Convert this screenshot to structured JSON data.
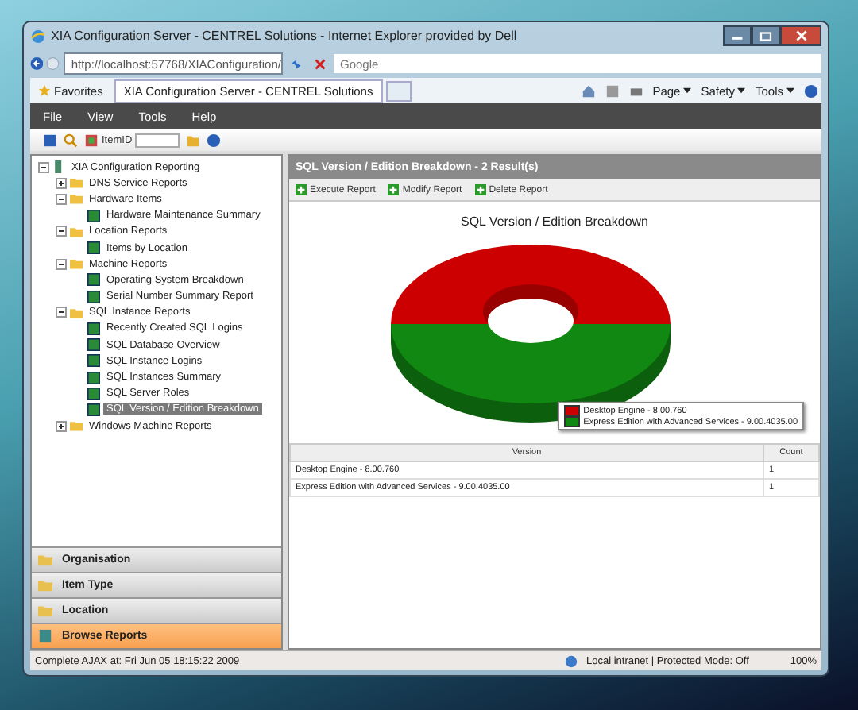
{
  "window": {
    "title": "XIA Configuration Server - CENTREL Solutions - Internet Explorer provided by Dell"
  },
  "address_bar": {
    "value": "http://localhost:57768/XIAConfiguration/"
  },
  "search": {
    "placeholder": "Google"
  },
  "favorites_bar": {
    "favorites": "Favorites",
    "tab": "XIA Configuration Server - CENTREL Solutions",
    "commands": [
      "Page",
      "Safety",
      "Tools"
    ]
  },
  "menu": [
    "File",
    "View",
    "Tools",
    "Help"
  ],
  "toolbar": {
    "item_id_label": "ItemID"
  },
  "tree": [
    {
      "label": "XIA Configuration Reporting",
      "kind": "root",
      "expanded": true,
      "selected": false,
      "children": [
        {
          "label": "DNS Service Reports",
          "kind": "folder",
          "expanded": false,
          "selected": false
        },
        {
          "label": "Hardware Items",
          "kind": "folder",
          "expanded": true,
          "selected": false,
          "children": [
            {
              "label": "Hardware Maintenance Summary",
              "kind": "report",
              "selected": false
            }
          ]
        },
        {
          "label": "Location Reports",
          "kind": "folder",
          "expanded": true,
          "selected": false,
          "children": [
            {
              "label": "Items by Location",
              "kind": "report",
              "selected": false
            }
          ]
        },
        {
          "label": "Machine Reports",
          "kind": "folder",
          "expanded": true,
          "selected": false,
          "children": [
            {
              "label": "Operating System Breakdown",
              "kind": "report",
              "selected": false
            },
            {
              "label": "Serial Number Summary Report",
              "kind": "report",
              "selected": false
            }
          ]
        },
        {
          "label": "SQL Instance Reports",
          "kind": "folder",
          "expanded": true,
          "selected": false,
          "children": [
            {
              "label": "Recently Created SQL Logins",
              "kind": "report",
              "selected": false
            },
            {
              "label": "SQL Database Overview",
              "kind": "report",
              "selected": false
            },
            {
              "label": "SQL Instance Logins",
              "kind": "report",
              "selected": false
            },
            {
              "label": "SQL Instances Summary",
              "kind": "report",
              "selected": false
            },
            {
              "label": "SQL Server Roles",
              "kind": "report",
              "selected": false
            },
            {
              "label": "SQL Version / Edition Breakdown",
              "kind": "report",
              "selected": true
            }
          ]
        },
        {
          "label": "Windows Machine Reports",
          "kind": "folder",
          "expanded": false,
          "selected": false
        }
      ]
    }
  ],
  "accordion": [
    {
      "label": "Organisation",
      "selected": false
    },
    {
      "label": "Item Type",
      "selected": false
    },
    {
      "label": "Location",
      "selected": false
    },
    {
      "label": "Browse Reports",
      "selected": true
    }
  ],
  "report": {
    "header": "SQL Version / Edition Breakdown - 2 Result(s)",
    "actions": [
      "Execute Report",
      "Modify Report",
      "Delete Report"
    ],
    "chart_title": "SQL Version / Edition Breakdown",
    "legend": [
      {
        "label": "Desktop Engine - 8.00.760",
        "color": "#cc0000"
      },
      {
        "label": "Express Edition with Advanced Services - 9.00.4035.00",
        "color": "#118811"
      }
    ],
    "table": {
      "columns": [
        "Version",
        "Count"
      ],
      "rows": [
        [
          "Desktop Engine - 8.00.760",
          "1"
        ],
        [
          "Express Edition with Advanced Services - 9.00.4035.00",
          "1"
        ]
      ]
    }
  },
  "status_bar": {
    "message": "Complete AJAX at: Fri Jun 05 18:15:22 2009",
    "zone": "Local intranet | Protected Mode: Off",
    "zoom": "100%"
  }
}
